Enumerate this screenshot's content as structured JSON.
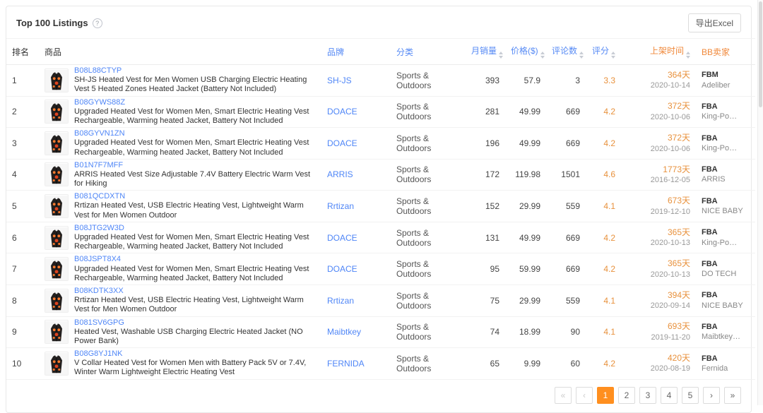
{
  "header": {
    "title": "Top 100 Listings",
    "help_glyph": "?",
    "export_label": "导出Excel"
  },
  "accent_colors": {
    "link_blue": "#4f86f7",
    "sort_orange": "#f0883a",
    "active_page_orange": "#ff8f1f"
  },
  "table": {
    "columns": [
      {
        "key": "rank",
        "label": "排名",
        "color": "dark",
        "sortable": false,
        "align": "left"
      },
      {
        "key": "product",
        "label": "商品",
        "color": "dark",
        "sortable": false,
        "align": "left"
      },
      {
        "key": "brand",
        "label": "品牌",
        "color": "blue",
        "sortable": false,
        "align": "left"
      },
      {
        "key": "category",
        "label": "分类",
        "color": "blue",
        "sortable": false,
        "align": "left"
      },
      {
        "key": "sales",
        "label": "月销量",
        "color": "blue",
        "sortable": true,
        "align": "right"
      },
      {
        "key": "price",
        "label": "价格($)",
        "color": "blue",
        "sortable": true,
        "align": "right"
      },
      {
        "key": "reviews",
        "label": "评论数",
        "color": "blue",
        "sortable": true,
        "align": "right"
      },
      {
        "key": "rating",
        "label": "评分",
        "color": "blue",
        "sortable": true,
        "align": "right"
      },
      {
        "key": "listed",
        "label": "上架时间",
        "color": "orange",
        "sortable": true,
        "align": "right"
      },
      {
        "key": "seller",
        "label": "BB卖家",
        "color": "orange",
        "sortable": false,
        "align": "left"
      }
    ],
    "rows": [
      {
        "rank": "1",
        "asin": "B08L88CTYP",
        "title": "SH-JS Heated Vest for Men Women USB Charging Electric Heating Vest 5 Heated Zones Heated Jacket (Battery Not Included)",
        "brand": "SH-JS",
        "category": "Sports & Outdoors",
        "sales": "393",
        "price": "57.9",
        "reviews": "3",
        "rating": "3.3",
        "age": "364天",
        "date": "2020-10-14",
        "fulfillment": "FBM",
        "seller": "Adeliber"
      },
      {
        "rank": "2",
        "asin": "B08GYWS88Z",
        "title": "Upgraded Heated Vest for Women Men, Smart Electric Heating Vest Rechargeable, Warming heated Jacket, Battery Not Included",
        "brand": "DOACE",
        "category": "Sports & Outdoors",
        "sales": "281",
        "price": "49.99",
        "reviews": "669",
        "rating": "4.2",
        "age": "372天",
        "date": "2020-10-06",
        "fulfillment": "FBA",
        "seller": "King-Po…"
      },
      {
        "rank": "3",
        "asin": "B08GYVN1ZN",
        "title": "Upgraded Heated Vest for Women Men, Smart Electric Heating Vest Rechargeable, Warming heated Jacket, Battery Not Included",
        "brand": "DOACE",
        "category": "Sports & Outdoors",
        "sales": "196",
        "price": "49.99",
        "reviews": "669",
        "rating": "4.2",
        "age": "372天",
        "date": "2020-10-06",
        "fulfillment": "FBA",
        "seller": "King-Po…"
      },
      {
        "rank": "4",
        "asin": "B01N7F7MFF",
        "title": "ARRIS Heated Vest Size Adjustable 7.4V Battery Electric Warm Vest for Hiking",
        "brand": "ARRIS",
        "category": "Sports & Outdoors",
        "sales": "172",
        "price": "119.98",
        "reviews": "1501",
        "rating": "4.6",
        "age": "1773天",
        "date": "2016-12-05",
        "fulfillment": "FBA",
        "seller": "ARRIS"
      },
      {
        "rank": "5",
        "asin": "B081QCDXTN",
        "title": "Rrtizan Heated Vest, USB Electric Heating Vest, Lightweight Warm Vest for Men Women Outdoor",
        "brand": "Rrtizan",
        "category": "Sports & Outdoors",
        "sales": "152",
        "price": "29.99",
        "reviews": "559",
        "rating": "4.1",
        "age": "673天",
        "date": "2019-12-10",
        "fulfillment": "FBA",
        "seller": "NICE BABY"
      },
      {
        "rank": "6",
        "asin": "B08JTG2W3D",
        "title": "Upgraded Heated Vest for Women Men, Smart Electric Heating Vest Rechargeable, Warming heated Jacket, Battery Not Included",
        "brand": "DOACE",
        "category": "Sports & Outdoors",
        "sales": "131",
        "price": "49.99",
        "reviews": "669",
        "rating": "4.2",
        "age": "365天",
        "date": "2020-10-13",
        "fulfillment": "FBA",
        "seller": "King-Po…"
      },
      {
        "rank": "7",
        "asin": "B08JSPT8X4",
        "title": "Upgraded Heated Vest for Women Men, Smart Electric Heating Vest Rechargeable, Warming heated Jacket, Battery Not Included",
        "brand": "DOACE",
        "category": "Sports & Outdoors",
        "sales": "95",
        "price": "59.99",
        "reviews": "669",
        "rating": "4.2",
        "age": "365天",
        "date": "2020-10-13",
        "fulfillment": "FBA",
        "seller": "DO TECH"
      },
      {
        "rank": "8",
        "asin": "B08KDTK3XX",
        "title": "Rrtizan Heated Vest, USB Electric Heating Vest, Lightweight Warm Vest for Men Women Outdoor",
        "brand": "Rrtizan",
        "category": "Sports & Outdoors",
        "sales": "75",
        "price": "29.99",
        "reviews": "559",
        "rating": "4.1",
        "age": "394天",
        "date": "2020-09-14",
        "fulfillment": "FBA",
        "seller": "NICE BABY"
      },
      {
        "rank": "9",
        "asin": "B081SV6GPG",
        "title": "Heated Vest, Washable USB Charging Electric Heated Jacket (NO Power Bank)",
        "brand": "Maibtkey",
        "category": "Sports & Outdoors",
        "sales": "74",
        "price": "18.99",
        "reviews": "90",
        "rating": "4.1",
        "age": "693天",
        "date": "2019-11-20",
        "fulfillment": "FBA",
        "seller": "Maibtkey…"
      },
      {
        "rank": "10",
        "asin": "B08G8YJ1NK",
        "title": "V Collar Heated Vest for Women Men with Battery Pack 5V or 7.4V, Winter Warm Lightweight Electric Heating Vest",
        "brand": "FERNIDA",
        "category": "Sports & Outdoors",
        "sales": "65",
        "price": "9.99",
        "reviews": "60",
        "rating": "4.2",
        "age": "420天",
        "date": "2020-08-19",
        "fulfillment": "FBA",
        "seller": "Fernida"
      }
    ]
  },
  "pagination": {
    "items": [
      {
        "label": "«",
        "name": "first-page-button",
        "disabled": true
      },
      {
        "label": "‹",
        "name": "prev-page-button",
        "disabled": true
      },
      {
        "label": "1",
        "name": "page-1-button",
        "active": true
      },
      {
        "label": "2",
        "name": "page-2-button"
      },
      {
        "label": "3",
        "name": "page-3-button"
      },
      {
        "label": "4",
        "name": "page-4-button"
      },
      {
        "label": "5",
        "name": "page-5-button"
      },
      {
        "label": "›",
        "name": "next-page-button"
      },
      {
        "label": "»",
        "name": "last-page-button"
      }
    ]
  }
}
